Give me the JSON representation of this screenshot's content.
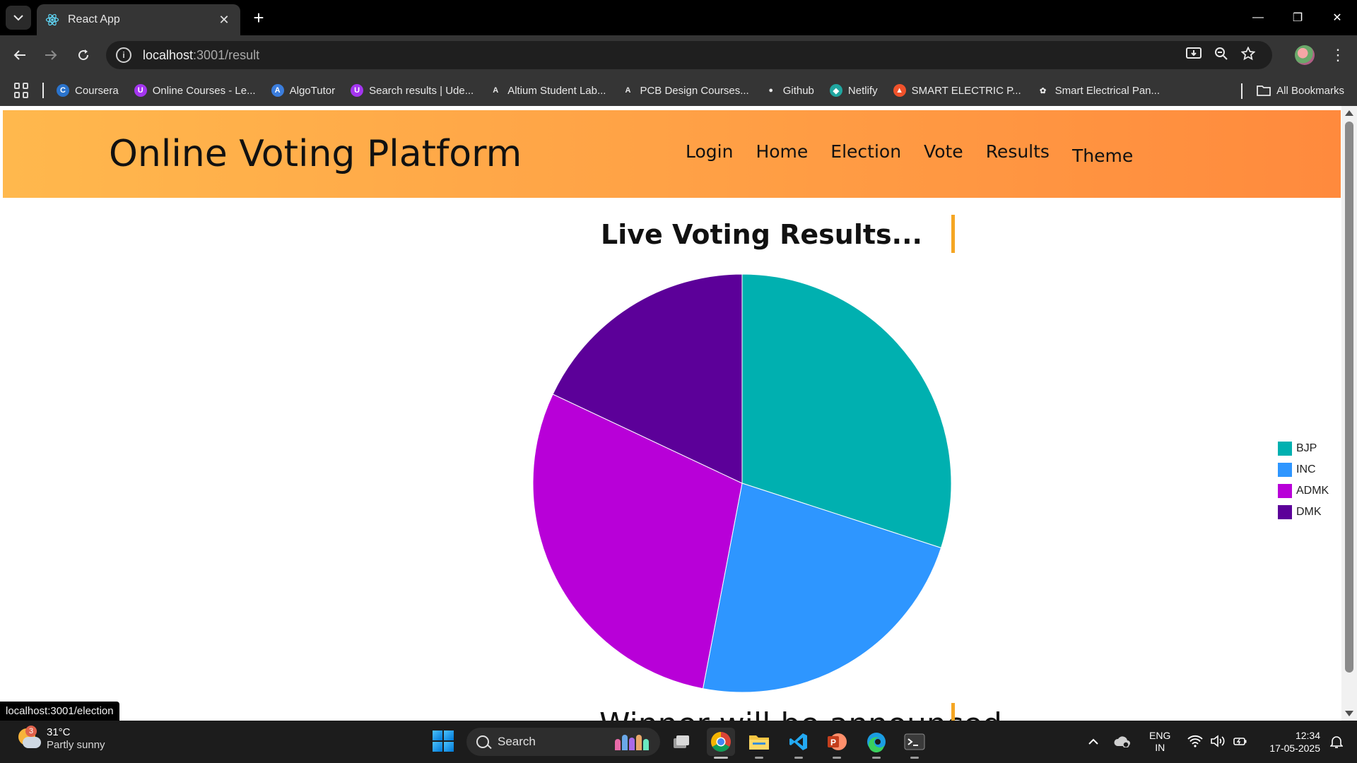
{
  "browser": {
    "tab_title": "React App",
    "url_host": "localhost",
    "url_rest": ":3001/result",
    "bookmarks": [
      {
        "label": "Coursera",
        "icon": "coursera-icon",
        "color": "#2a73cc"
      },
      {
        "label": "Online Courses - Le...",
        "icon": "udemy-icon",
        "color": "#a435f0"
      },
      {
        "label": "AlgoTutor",
        "icon": "algotutor-icon",
        "color": "#3b7ddd"
      },
      {
        "label": "Search results | Ude...",
        "icon": "udemy-icon",
        "color": "#a435f0"
      },
      {
        "label": "Altium Student Lab...",
        "icon": "altium-icon",
        "color": "#e8e8e8"
      },
      {
        "label": "PCB Design Courses...",
        "icon": "altium-icon",
        "color": "#e8e8e8"
      },
      {
        "label": "Github",
        "icon": "github-icon",
        "color": "#e8e8e8"
      },
      {
        "label": "Netlify",
        "icon": "netlify-icon",
        "color": "#20a6a0"
      },
      {
        "label": "SMART ELECTRIC P...",
        "icon": "flame-icon",
        "color": "#f0522b"
      },
      {
        "label": "Smart Electrical Pan...",
        "icon": "openai-icon",
        "color": "#e8e8e8"
      }
    ],
    "all_bookmarks": "All Bookmarks",
    "status_url": "localhost:3001/election"
  },
  "site": {
    "title": "Online Voting Platform",
    "nav": {
      "login": "Login",
      "home": "Home",
      "election": "Election",
      "vote": "Vote",
      "results": "Results",
      "theme": "Theme"
    },
    "results_heading": "Live Voting Results...",
    "winner_partial": "Winner will be announced"
  },
  "chart_data": {
    "type": "pie",
    "title": "",
    "categories": [
      "BJP",
      "INC",
      "ADMK",
      "DMK"
    ],
    "values": [
      30,
      23,
      29,
      18
    ],
    "colors": [
      "#00b0b0",
      "#2e96ff",
      "#b800d8",
      "#5c0099"
    ],
    "legend_position": "right"
  },
  "taskbar": {
    "weather_temp": "31°C",
    "weather_condition": "Partly sunny",
    "weather_badge": "3",
    "search_label": "Search",
    "lang_top": "ENG",
    "lang_bottom": "IN",
    "time": "12:34",
    "date": "17-05-2025"
  }
}
